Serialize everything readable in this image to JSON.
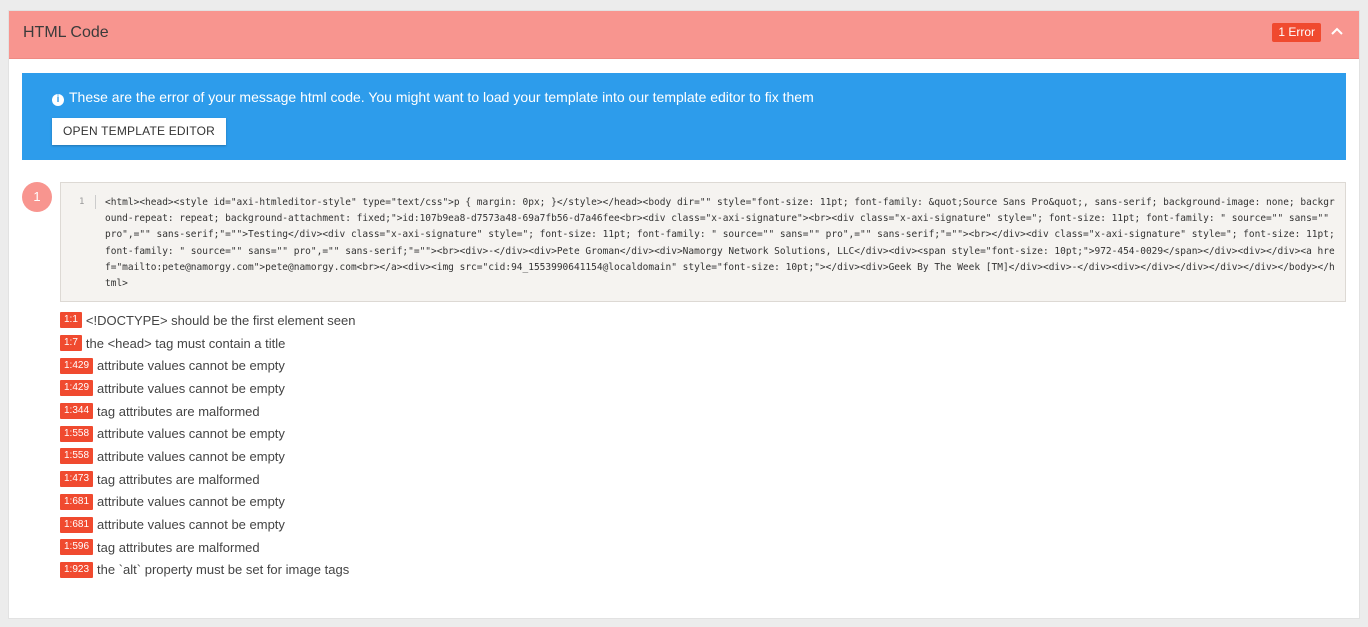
{
  "panel": {
    "title": "HTML Code",
    "error_badge": "1 Error"
  },
  "alert": {
    "icon": "info-icon",
    "text": "These are the error of your message html code. You might want to load your template into our template editor to fix them",
    "button_label": "OPEN TEMPLATE EDITOR"
  },
  "item": {
    "number": "1",
    "line_number": "1",
    "code": "<html><head><style id=\"axi-htmleditor-style\" type=\"text/css\">p { margin: 0px; }</style></head><body dir=\"\" style=\"font-size: 11pt; font-family: &quot;Source Sans Pro&quot;, sans-serif; background-image: none; background-repeat: repeat; background-attachment: fixed;\">id:107b9ea8-d7573a48-69a7fb56-d7a46fee<br><div class=\"x-axi-signature\"><br><div class=\"x-axi-signature\" style=\"; font-size: 11pt; font-family: \" source=\"\" sans=\"\" pro\",=\"\" sans-serif;\"=\"\">Testing</div><div class=\"x-axi-signature\" style=\"; font-size: 11pt; font-family: \" source=\"\" sans=\"\" pro\",=\"\" sans-serif;\"=\"\"><br></div><div class=\"x-axi-signature\" style=\"; font-size: 11pt; font-family: \" source=\"\" sans=\"\" pro\",=\"\" sans-serif;\"=\"\"><br><div>-</div><div>Pete Groman</div><div>Namorgy Network Solutions, LLC</div><div><span style=\"font-size: 10pt;\">972-454-0029</span></div><div></div><a href=\"mailto:pete@namorgy.com\">pete@namorgy.com<br></a><div><img src=\"cid:94_1553990641154@localdomain\" style=\"font-size: 10pt;\"></div><div>Geek By The Week [TM]</div><div>-</div><div></div></div></div></div></body></html>",
    "errors": [
      {
        "position": "1:1",
        "message": "<!DOCTYPE> should be the first element seen"
      },
      {
        "position": "1:7",
        "message": "the <head> tag must contain a title"
      },
      {
        "position": "1:429",
        "message": "attribute values cannot be empty"
      },
      {
        "position": "1:429",
        "message": "attribute values cannot be empty"
      },
      {
        "position": "1:344",
        "message": "tag attributes are malformed"
      },
      {
        "position": "1:558",
        "message": "attribute values cannot be empty"
      },
      {
        "position": "1:558",
        "message": "attribute values cannot be empty"
      },
      {
        "position": "1:473",
        "message": "tag attributes are malformed"
      },
      {
        "position": "1:681",
        "message": "attribute values cannot be empty"
      },
      {
        "position": "1:681",
        "message": "attribute values cannot be empty"
      },
      {
        "position": "1:596",
        "message": "tag attributes are malformed"
      },
      {
        "position": "1:923",
        "message": "the `alt` property must be set for image tags"
      }
    ]
  },
  "colors": {
    "header_bg": "#f8958f",
    "error_red": "#f04a2f",
    "info_blue": "#2d9ceb"
  }
}
